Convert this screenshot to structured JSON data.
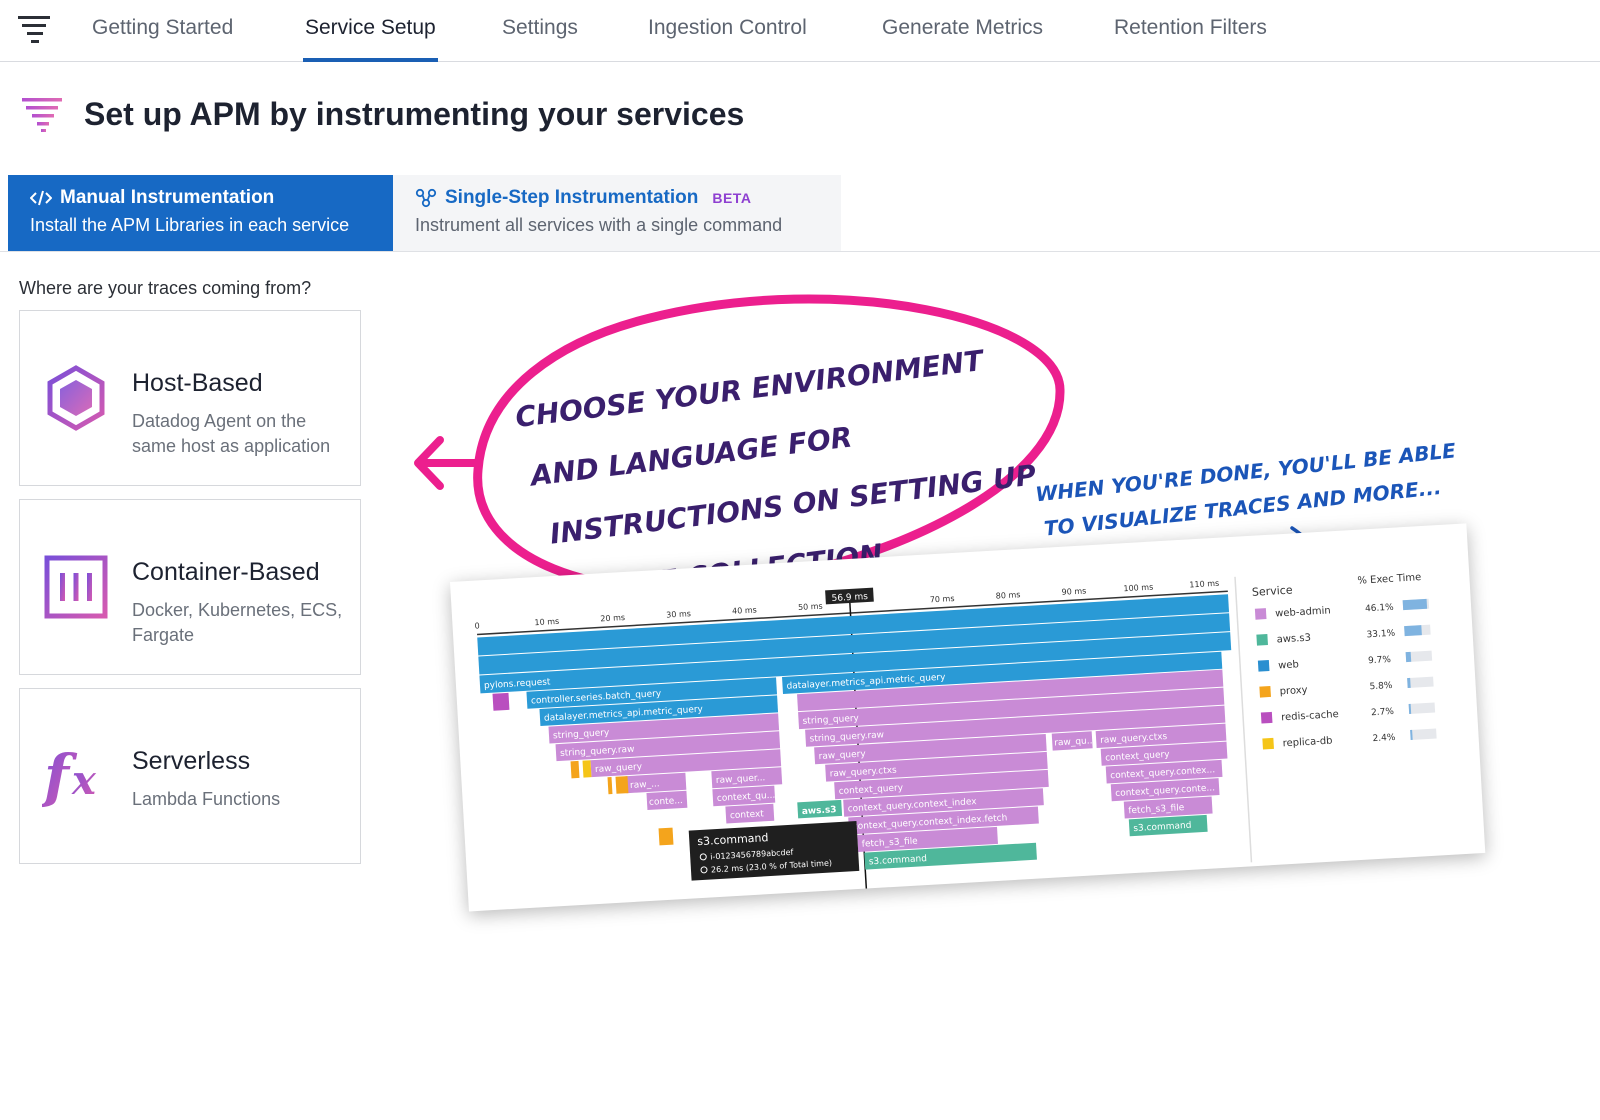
{
  "nav": {
    "tabs": [
      {
        "label": "Getting Started"
      },
      {
        "label": "Service Setup"
      },
      {
        "label": "Settings"
      },
      {
        "label": "Ingestion Control"
      },
      {
        "label": "Generate Metrics"
      },
      {
        "label": "Retention Filters"
      }
    ],
    "active_tab": "Service Setup",
    "menu_icon": "list-filter-icon"
  },
  "page": {
    "title": "Set up APM by instrumenting your services",
    "title_icon": "apm-filter-icon"
  },
  "methods": {
    "manual": {
      "title": "Manual Instrumentation",
      "subtitle": "Install the APM Libraries in each service",
      "icon": "code-icon"
    },
    "single": {
      "title": "Single-Step Instrumentation",
      "badge": "BETA",
      "subtitle": "Instrument all services with a single command",
      "icon": "network-icon"
    }
  },
  "question": "Where are your traces coming from?",
  "cards": [
    {
      "title": "Host-Based",
      "desc": "Datadog Agent on the same host as application",
      "icon": "hexagon-icon"
    },
    {
      "title": "Container-Based",
      "desc": "Docker, Kubernetes, ECS, Fargate",
      "icon": "container-icon"
    },
    {
      "title": "Serverless",
      "desc": "Lambda Functions",
      "icon": "function-icon"
    }
  ],
  "annotations": {
    "main": [
      "CHOOSE YOUR ENVIRONMENT",
      "AND LANGUAGE FOR",
      "INSTRUCTIONS ON SETTING UP",
      "TRACE COLLECTION."
    ],
    "secondary": [
      "WHEN YOU'RE DONE, YOU'LL BE ABLE",
      "TO VISUALIZE TRACES AND MORE..."
    ]
  },
  "flamegraph": {
    "cursor_label": "56.9 ms",
    "ticks": [
      "0",
      "10 ms",
      "20 ms",
      "30 ms",
      "40 ms",
      "50 ms",
      "70 ms",
      "80 ms",
      "90 ms",
      "100 ms",
      "110 ms"
    ],
    "spans": [
      "pylons.request",
      "controller.series.batch_query",
      "datalayer.metrics_api.metric_query",
      "datalayer.metrics_api.metric_query",
      "string_query",
      "string_query",
      "string_query.raw",
      "string_query.raw",
      "raw_query",
      "raw_query",
      "raw_query.ctxs",
      "raw_query.ctxs",
      "raw_qu...",
      "raw_...",
      "raw_quer...",
      "context_query",
      "context_query",
      "conte...",
      "context_qu...",
      "context",
      "context_query.context_index",
      "context_query.contex...",
      "context_query.context_index.fetch",
      "context_query.conte...",
      "fetch_s3_file",
      "fetch_s3_file",
      "s3.command",
      "s3.command",
      "aws.s3"
    ],
    "tooltip": {
      "title": "s3.command",
      "host": "i-0123456789abcdef",
      "duration": "26.2 ms (23.0 % of Total time)"
    },
    "legend": {
      "service_header": "Service",
      "exec_header": "% Exec Time",
      "items": [
        {
          "name": "web-admin",
          "pct": "46.1%",
          "value": 46.1,
          "color": "#c98bd6"
        },
        {
          "name": "aws.s3",
          "pct": "33.1%",
          "value": 33.1,
          "color": "#4fb79b"
        },
        {
          "name": "web",
          "pct": "9.7%",
          "value": 9.7,
          "color": "#2a8fd0"
        },
        {
          "name": "proxy",
          "pct": "5.8%",
          "value": 5.8,
          "color": "#f4a41c"
        },
        {
          "name": "redis-cache",
          "pct": "2.7%",
          "value": 2.7,
          "color": "#b94fbf"
        },
        {
          "name": "replica-db",
          "pct": "2.4%",
          "value": 2.4,
          "color": "#f5c518"
        }
      ]
    }
  },
  "colors": {
    "accent": "#1769c4",
    "annotation": "#ec1f8e",
    "annotation_text": "#3a1f6d",
    "secondary_annotation": "#1b55b8"
  }
}
